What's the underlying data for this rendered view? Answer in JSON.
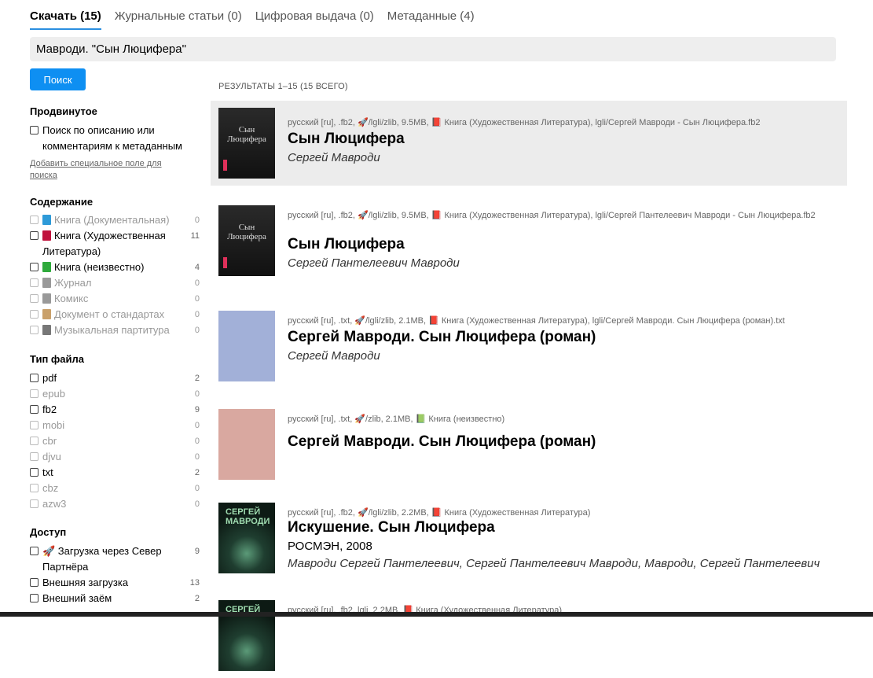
{
  "tabs": {
    "download": "Скачать (15)",
    "journal": "Журнальные статьи (0)",
    "digital": "Цифровая выдача (0)",
    "metadata": "Метаданные (4)"
  },
  "search": {
    "value": "Мавроди. \"Сын Люцифера\"",
    "button": "Поиск"
  },
  "results_count": "РЕЗУЛЬТАТЫ 1–15 (15 ВСЕГО)",
  "sidebar": {
    "advanced": {
      "title": "Продвинутое",
      "desc_search": "Поиск по описанию или комментариям к метаданным",
      "add_field": "Добавить специальное поле для поиска"
    },
    "content": {
      "title": "Содержание",
      "items": [
        {
          "label": "Книга (Документальная)",
          "count": "0",
          "icon": "book-blue-icon",
          "color": "#2e9ad8"
        },
        {
          "label": "Книга (Художественная Литература)",
          "count": "11",
          "icon": "book-red-icon",
          "color": "#c0123c"
        },
        {
          "label": "Книга (неизвестно)",
          "count": "4",
          "icon": "book-green-icon",
          "color": "#2faa3c"
        },
        {
          "label": "Журнал",
          "count": "0",
          "icon": "newspaper-icon",
          "color": "#999999"
        },
        {
          "label": "Комикс",
          "count": "0",
          "icon": "speech-bubble-icon",
          "color": "#999999"
        },
        {
          "label": "Документ о стандартах",
          "count": "0",
          "icon": "scroll-icon",
          "color": "#c9a06a"
        },
        {
          "label": "Музыкальная партитура",
          "count": "0",
          "icon": "music-notes-icon",
          "color": "#777777"
        }
      ]
    },
    "filetype": {
      "title": "Тип файла",
      "items": [
        {
          "label": "pdf",
          "count": "2"
        },
        {
          "label": "epub",
          "count": "0"
        },
        {
          "label": "fb2",
          "count": "9"
        },
        {
          "label": "mobi",
          "count": "0"
        },
        {
          "label": "cbr",
          "count": "0"
        },
        {
          "label": "djvu",
          "count": "0"
        },
        {
          "label": "txt",
          "count": "2"
        },
        {
          "label": "cbz",
          "count": "0"
        },
        {
          "label": "azw3",
          "count": "0"
        }
      ]
    },
    "access": {
      "title": "Доступ",
      "items": [
        {
          "label": "🚀 Загрузка через Север Партнёра",
          "count": "9"
        },
        {
          "label": "Внешняя загрузка",
          "count": "13"
        },
        {
          "label": "Внешний заём",
          "count": "2"
        }
      ]
    }
  },
  "results": [
    {
      "meta": "русский [ru], .fb2, 🚀/lgli/zlib, 9.5MB, 📕 Книга (Художественная Литература), lgli/Сергей Мавроди - Сын Люцифера.fb2",
      "title": "Сын Люцифера",
      "author": "Сергей Мавроди",
      "cover": "dark",
      "cover_text": "Сын Люцифера"
    },
    {
      "meta": "русский [ru], .fb2, 🚀/lgli/zlib, 9.5MB, 📕 Книга (Художественная Литература), lgli/Сергей Пантелеевич Мавроди - Сын Люцифера.fb2",
      "title": "Сын Люцифера",
      "author": "Сергей Пантелеевич Мавроди",
      "cover": "dark",
      "cover_text": "Сын Люцифера"
    },
    {
      "meta": "русский [ru], .txt, 🚀/lgli/zlib, 2.1MB, 📕 Книга (Художественная Литература), lgli/Сергей Мавроди. Сын Люцифера (роман).txt",
      "title": "Сергей Мавроди. Сын Люцифера (роман)",
      "author": "Сергей Мавроди",
      "cover": "#a2b0d8"
    },
    {
      "meta": "русский [ru], .txt, 🚀/zlib, 2.1MB, 📗 Книга (неизвестно)",
      "title": "Сергей Мавроди. Сын Люцифера (роман)",
      "author": "",
      "cover": "#d9a8a0"
    },
    {
      "meta": "русский [ru], .fb2, 🚀/lgli/zlib, 2.2MB, 📕 Книга (Художественная Литература)",
      "title": "Искушение. Сын Люцифера",
      "publisher": "РОСМЭН, 2008",
      "author": "Мавроди Сергей Пантелеевич, Сергей Пантелеевич Мавроди, Мавроди, Сергей Пантелеевич",
      "cover": "green",
      "cover_text": "СЕРГЕЙ МАВРОДИ"
    },
    {
      "meta": "русский [ru], .fb2, lgli, 2.2MB, 📕 Книга (Художественная Литература)",
      "cover": "green",
      "cover_text": "СЕРГЕЙ"
    }
  ]
}
